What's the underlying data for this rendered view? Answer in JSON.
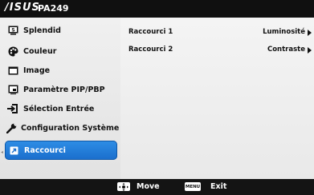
{
  "header": {
    "brand": "/ISUS",
    "model": "PA249"
  },
  "sidebar": {
    "items": [
      {
        "label": "Splendid",
        "icon": "splendid-icon",
        "active": false
      },
      {
        "label": "Couleur",
        "icon": "palette-icon",
        "active": false
      },
      {
        "label": "Image",
        "icon": "image-icon",
        "active": false
      },
      {
        "label": "Paramètre PIP/PBP",
        "icon": "pip-icon",
        "active": false
      },
      {
        "label": "Sélection Entrée",
        "icon": "input-icon",
        "active": false
      },
      {
        "label": "Configuration Système",
        "icon": "wrench-icon",
        "active": false
      },
      {
        "label": "Raccourci",
        "icon": "shortcut-icon",
        "active": true
      }
    ]
  },
  "content": {
    "rows": [
      {
        "name": "Raccourci 1",
        "value": "Luminosité"
      },
      {
        "name": "Raccourci 2",
        "value": "Contraste"
      }
    ]
  },
  "footer": {
    "move_label": "Move",
    "menu_key": "MENU",
    "exit_label": "Exit"
  },
  "colors": {
    "active_item": "#1f7bd8",
    "sidebar_bg": "#ececec",
    "footer_bg": "#141414"
  }
}
